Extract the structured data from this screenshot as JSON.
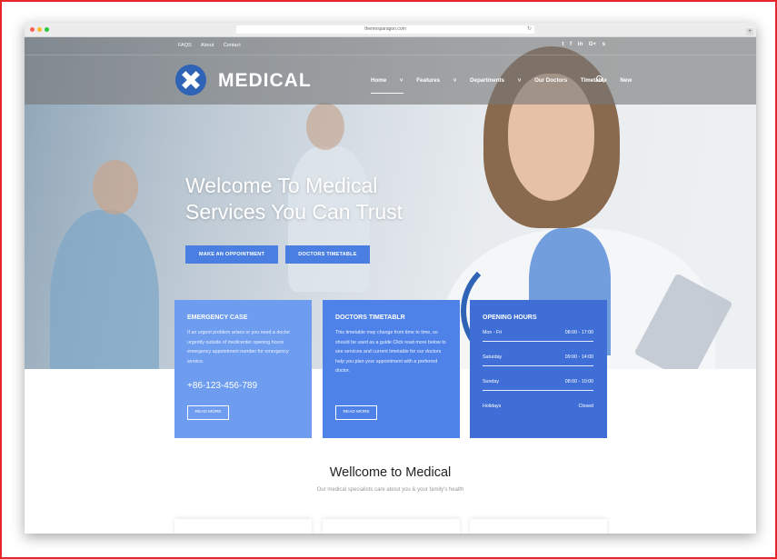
{
  "browser": {
    "url": "themesparagon.com"
  },
  "topbar": {
    "links": [
      "FAQS",
      "About",
      "Contact"
    ],
    "social_icons": [
      "twitter-icon",
      "facebook-icon",
      "linkedin-icon",
      "google-plus-icon",
      "skype-icon"
    ]
  },
  "brand": {
    "name": "MEDICAL"
  },
  "nav": {
    "items": [
      "Home",
      "Features",
      "Departments",
      "Our Doctors",
      "Timetable",
      "New"
    ],
    "active": "Home"
  },
  "hero": {
    "headline_line1": "Welcome To Medical",
    "headline_line2": "Services You Can Trust",
    "primary_button": "MAKE AN OPPOINTMENT",
    "secondary_button": "DOCTORS TIMETABLE"
  },
  "cards": {
    "emergency": {
      "title": "EMERGENCY CASE",
      "text": "If an urgent problem arises or you need a doctor urgently outside of medicenter opening hours emergency appointment number for emergency service.",
      "phone": "+86-123-456-789",
      "button": "READ MORE"
    },
    "timetable": {
      "title": "DOCTORS TIMETABLR",
      "text": "This timetable may change from time to time, so should be used as a guide Click read more below to see services and current timetable for our doctors help you plan your appointment with a preferred doctor.",
      "button": "READ MORE"
    },
    "hours": {
      "title": "OPENING HOURS",
      "rows": [
        {
          "day": "Mon - Fri",
          "time": "08:00 - 17:00"
        },
        {
          "day": "Saturday",
          "time": "09:00 - 14:00"
        },
        {
          "day": "Sunday",
          "time": "08:00 - 10:00"
        },
        {
          "day": "Holidays",
          "time": "Closed"
        }
      ]
    }
  },
  "welcome": {
    "title": "Wellcome to Medical",
    "subtitle": "Our medical specialists care about you & your family's health"
  },
  "colors": {
    "brand_blue": "#2f63b5",
    "card_light": "#6e9df0",
    "card_mid": "#4f82e8",
    "card_dark": "#3f6fd6"
  }
}
